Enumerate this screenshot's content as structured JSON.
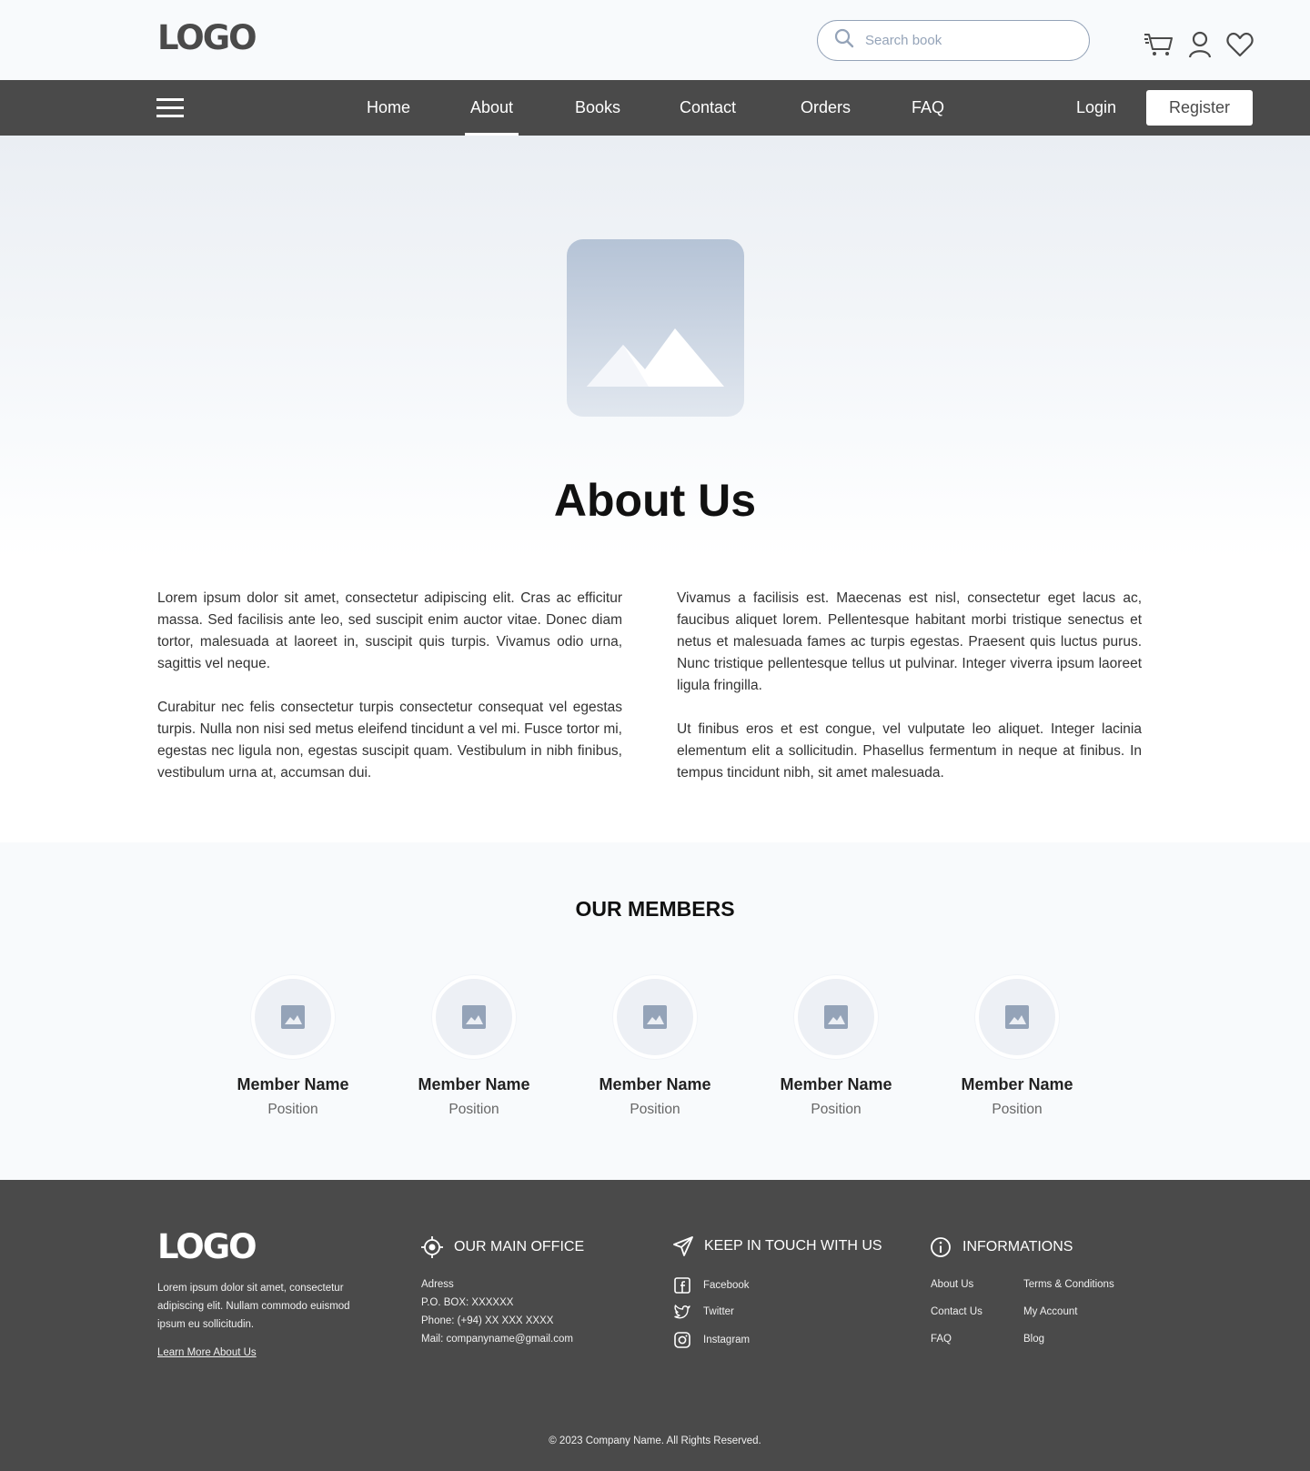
{
  "header": {
    "logo": "LOGO",
    "search": {
      "placeholder": "Search book"
    },
    "icons": [
      "cart-icon",
      "user-icon",
      "heart-icon"
    ]
  },
  "nav": {
    "items": [
      {
        "label": "Home"
      },
      {
        "label": "About",
        "active": true
      },
      {
        "label": "Books"
      },
      {
        "label": "Contact"
      },
      {
        "label": "Orders"
      },
      {
        "label": "FAQ"
      }
    ],
    "login": "Login",
    "register": "Register"
  },
  "hero": {
    "title": "About Us"
  },
  "about": {
    "left": [
      "Lorem ipsum dolor sit amet, consectetur adipiscing elit. Cras ac efficitur massa. Sed facilisis ante leo, sed suscipit enim auctor vitae. Donec diam tortor, malesuada at laoreet in, suscipit quis turpis. Vivamus odio urna, sagittis vel neque.",
      "Curabitur nec felis consectetur turpis consectetur consequat vel egestas turpis. Nulla non nisi sed metus eleifend tincidunt a vel mi. Fusce tortor mi, egestas nec ligula non, egestas suscipit quam. Vestibulum in nibh finibus, vestibulum urna at, accumsan dui."
    ],
    "right": [
      "Vivamus a facilisis est. Maecenas est nisl, consectetur eget lacus ac, faucibus aliquet lorem. Pellentesque habitant morbi tristique senectus et netus et malesuada fames ac turpis egestas. Praesent quis luctus purus. Nunc tristique pellentesque tellus ut pulvinar. Integer viverra ipsum laoreet ligula fringilla.",
      "Ut finibus eros et est congue, vel vulputate leo aliquet. Integer lacinia elementum elit a sollicitudin. Phasellus fermentum in neque at finibus. In tempus tincidunt nibh, sit amet malesuada."
    ]
  },
  "members": {
    "title": "OUR MEMBERS",
    "list": [
      {
        "name": "Member Name",
        "position": "Position"
      },
      {
        "name": "Member Name",
        "position": "Position"
      },
      {
        "name": "Member Name",
        "position": "Position"
      },
      {
        "name": "Member Name",
        "position": "Position"
      },
      {
        "name": "Member Name",
        "position": "Position"
      }
    ]
  },
  "footer": {
    "logo": "LOGO",
    "description": "Lorem ipsum dolor sit amet, consectetur adipiscing elit. Nullam commodo euismod ipsum eu sollicitudin.",
    "learn_more": "Learn More About Us",
    "office": {
      "heading": "OUR MAIN OFFICE",
      "lines": [
        "Adress",
        "P.O. BOX: XXXXXX",
        "Phone: (+94) XX XXX XXXX",
        "Mail: companyname@gmail.com"
      ]
    },
    "touch": {
      "heading": "KEEP IN TOUCH WITH US",
      "links": [
        "Facebook",
        "Twitter",
        "Instagram"
      ]
    },
    "info": {
      "heading": "INFORMATIONS",
      "col1": [
        "About Us",
        "Contact Us",
        "FAQ"
      ],
      "col2": [
        "Terms & Conditions",
        "My Account",
        "Blog"
      ]
    },
    "copyright": "© 2023 Company Name. All Rights Reserved."
  },
  "colors": {
    "nav_bg": "#4a4a4a",
    "page_bg": "#f8fafc",
    "placeholder_img": "#b5c3d6"
  }
}
